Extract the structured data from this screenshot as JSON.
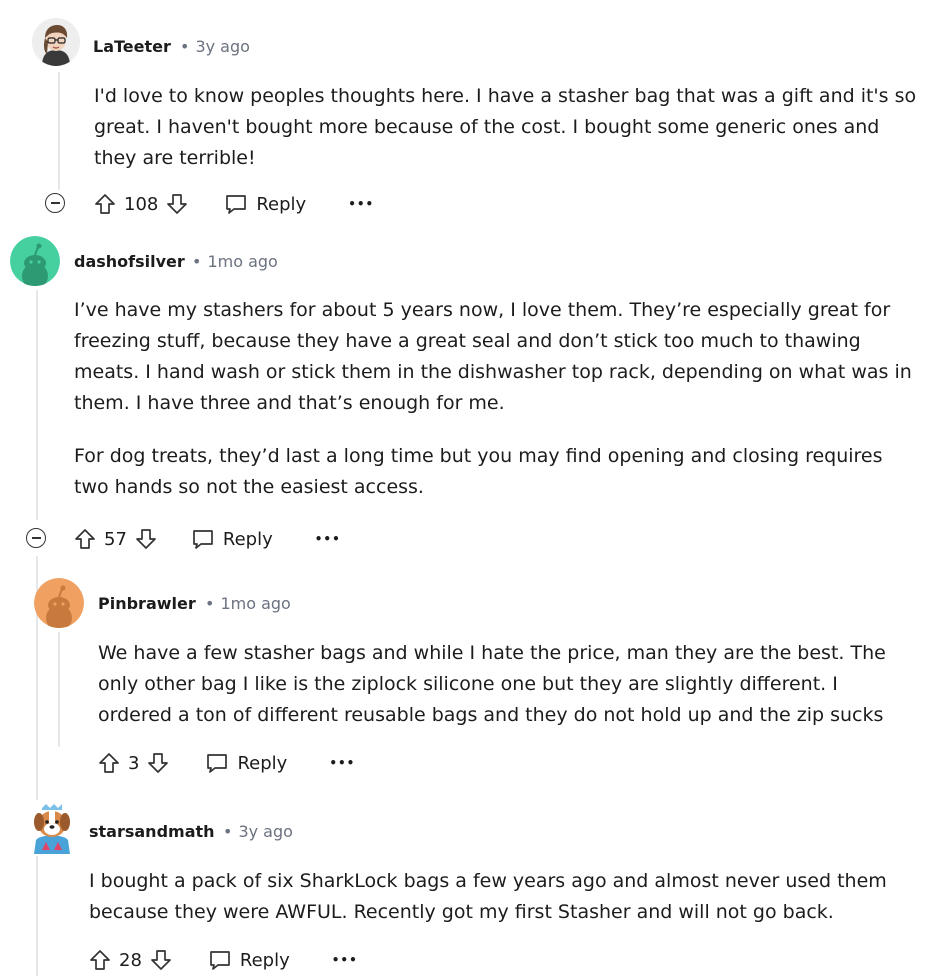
{
  "comments": [
    {
      "author": "LaTeeter",
      "time": "3y ago",
      "body": [
        "I'd love to know peoples thoughts here. I have a stasher bag that was a gift and it's so great. I haven't bought more because of the cost. I bought some generic ones and they are terrible!"
      ],
      "votes": "108",
      "reply_label": "Reply",
      "avatar_icon": "user-avatar-icon"
    },
    {
      "author": "dashofsilver",
      "time": "1mo ago",
      "body": [
        "I’ve have my stashers for about 5 years now, I love them. They’re especially great for freezing stuff, because they have a great seal and don’t stick too much to thawing meats. I hand wash or stick them in the dishwasher top rack, depending on what was in them. I have three and that’s enough for me.",
        "For dog treats, they’d last a long time but you may find opening and closing requires two hands so not the easiest access."
      ],
      "votes": "57",
      "reply_label": "Reply",
      "avatar_color": "#46d0a0"
    },
    {
      "author": "Pinbrawler",
      "time": "1mo ago",
      "body": [
        "We have a few stasher bags and while I hate the price, man they are the best. The only other bag I like is the ziplock silicone one but they are slightly different. I ordered a ton of different reusable bags and they do not hold up and the zip sucks"
      ],
      "votes": "3",
      "reply_label": "Reply",
      "avatar_color": "#f0a060"
    },
    {
      "author": "starsandmath",
      "time": "3y ago",
      "body": [
        "I bought a pack of six SharkLock bags a few years ago and almost never used them because they were AWFUL. Recently got my first Stasher and will not go back."
      ],
      "votes": "28",
      "reply_label": "Reply",
      "avatar_icon": "dog-avatar-icon"
    }
  ],
  "separator": "•",
  "more_label": "•••"
}
